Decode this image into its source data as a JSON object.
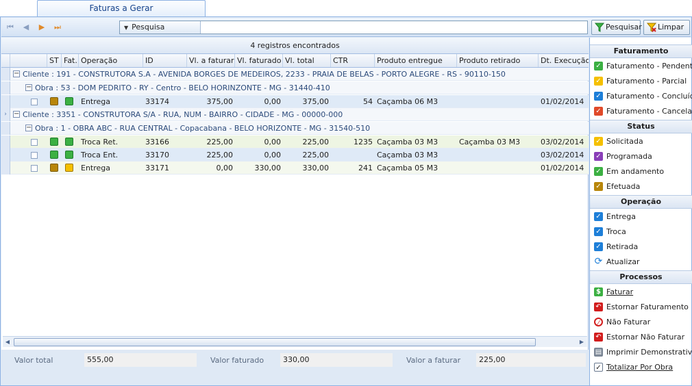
{
  "tab": {
    "label": "Faturas a Gerar"
  },
  "toolbar": {
    "nav": [
      "⏮",
      "◀",
      "▶",
      "⏭"
    ],
    "search_label": "Pesquisa",
    "search_value": "",
    "btn_search": "Pesquisar",
    "btn_clear": "Limpar"
  },
  "grid": {
    "record_count": "4 registros encontrados",
    "columns": [
      "ST",
      "Fat.",
      "Operação",
      "ID",
      "Vl. a faturar",
      "Vl. faturado",
      "Vl. total",
      "CTR",
      "Produto entregue",
      "Produto retirado",
      "Dt. Execução"
    ],
    "groups": [
      {
        "cliente": "Cliente : 191 - CONSTRUTORA S.A - AVENIDA BORGES DE MEDEIROS, 2233 - PRAIA DE BELAS - PORTO ALEGRE - RS - 90110-150",
        "obra": "Obra : 53 - DOM PEDRITO - RY - Centro - BELO HORINZONTE - MG - 31440-410"
      },
      {
        "cliente": "Cliente : 3351 - CONSTRUTORA S/A - RUA, NUM - BAIRRO - CIDADE - MG - 00000-000",
        "obra": "Obra : 1 - OBRA ABC - RUA CENTRAL - Copacabana - BELO HORIZONTE - MG - 31540-510"
      }
    ],
    "rows": [
      {
        "operacao": "Entrega",
        "id": "33174",
        "vl_a_faturar": "375,00",
        "vl_faturado": "0,00",
        "vl_total": "375,00",
        "ctr": "54",
        "prod_entregue": "Caçamba 06 M3",
        "prod_retirado": "",
        "dt": "01/02/2014",
        "st": "#b8860b",
        "fat": "#3cb043"
      },
      {
        "operacao": "Troca Ret.",
        "id": "33166",
        "vl_a_faturar": "225,00",
        "vl_faturado": "0,00",
        "vl_total": "225,00",
        "ctr": "1235",
        "prod_entregue": "Caçamba 03 M3",
        "prod_retirado": "Caçamba 03 M3",
        "dt": "03/02/2014",
        "st": "#3cb043",
        "fat": "#3cb043"
      },
      {
        "operacao": "Troca Ent.",
        "id": "33170",
        "vl_a_faturar": "225,00",
        "vl_faturado": "0,00",
        "vl_total": "225,00",
        "ctr": "",
        "prod_entregue": "Caçamba 03 M3",
        "prod_retirado": "",
        "dt": "03/02/2014",
        "st": "#3cb043",
        "fat": "#3cb043"
      },
      {
        "operacao": "Entrega",
        "id": "33171",
        "vl_a_faturar": "0,00",
        "vl_faturado": "330,00",
        "vl_total": "330,00",
        "ctr": "241",
        "prod_entregue": "Caçamba 05 M3",
        "prod_retirado": "",
        "dt": "01/02/2014",
        "st": "#b8860b",
        "fat": "#f5c000"
      }
    ]
  },
  "footer": {
    "valor_total_label": "Valor total",
    "valor_total": "555,00",
    "valor_faturado_label": "Valor faturado",
    "valor_faturado": "330,00",
    "valor_a_faturar_label": "Valor a faturar",
    "valor_a_faturar": "225,00"
  },
  "side": {
    "faturamento": {
      "title": "Faturamento",
      "items": [
        {
          "label": "Faturamento - Pendente",
          "color": "#3cb043"
        },
        {
          "label": "Faturamento - Parcial",
          "color": "#f5c000"
        },
        {
          "label": "Faturamento - Concluído",
          "color": "#1e7fd8"
        },
        {
          "label": "Faturamento - Cancelado",
          "color": "#e04a2a"
        }
      ]
    },
    "status": {
      "title": "Status",
      "items": [
        {
          "label": "Solicitada",
          "color": "#f5c000"
        },
        {
          "label": "Programada",
          "color": "#8a3fb8"
        },
        {
          "label": "Em andamento",
          "color": "#3cb043"
        },
        {
          "label": "Efetuada",
          "color": "#b8860b"
        }
      ]
    },
    "operacao": {
      "title": "Operação",
      "items": [
        {
          "label": "Entrega",
          "color": "#1e7fd8"
        },
        {
          "label": "Troca",
          "color": "#1e7fd8"
        },
        {
          "label": "Retirada",
          "color": "#1e7fd8"
        },
        {
          "label": "Atualizar",
          "color": "#1e7fd8"
        }
      ]
    },
    "processos": {
      "title": "Processos",
      "items": [
        {
          "label": "Faturar"
        },
        {
          "label": "Estornar Faturamento"
        },
        {
          "label": "Não Faturar"
        },
        {
          "label": "Estornar Não Faturar"
        },
        {
          "label": "Imprimir Demonstrativo"
        },
        {
          "label": "Totalizar Por Obra"
        }
      ]
    }
  }
}
